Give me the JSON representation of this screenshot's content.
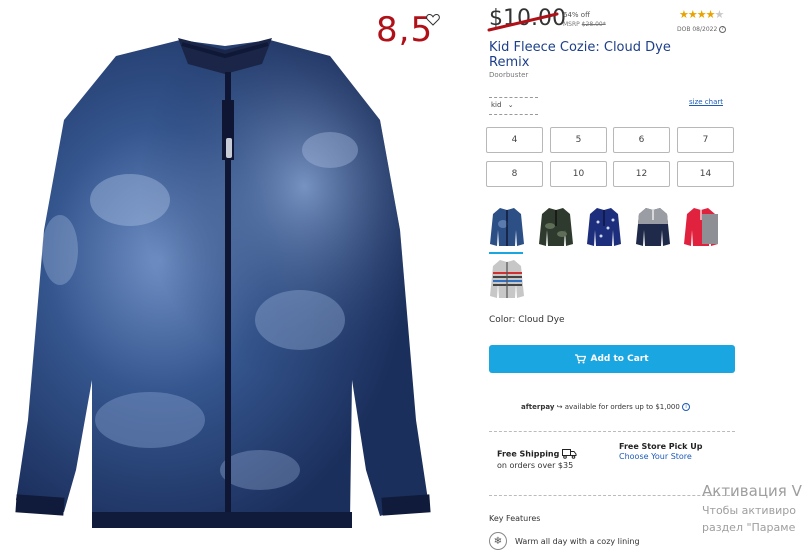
{
  "image": {
    "price_overlay": "8,5",
    "alt_subject": "jacket-image"
  },
  "product": {
    "price": "$10.00",
    "percent_off": "64% off",
    "msrp_label": "MSRP",
    "msrp_value": "$28.00*",
    "rating_stars": 4,
    "dob": "DOB 08/2022",
    "title": "Kid Fleece Cozie: Cloud Dye Remix",
    "subtitle": "Doorbuster"
  },
  "size_selector": {
    "selected": "kid",
    "size_chart_label": "size chart",
    "sizes": [
      "4",
      "5",
      "6",
      "7",
      "8",
      "10",
      "12",
      "14"
    ]
  },
  "swatches": [
    {
      "name": "cloud-dye",
      "colors": [
        "#2c4f86",
        "#1a2f5a"
      ],
      "selected": true
    },
    {
      "name": "camo",
      "colors": [
        "#2e3a2e",
        "#4f5d4a"
      ],
      "selected": false
    },
    {
      "name": "navy-print",
      "colors": [
        "#1d2f7c",
        "#3f55b5"
      ],
      "selected": false
    },
    {
      "name": "grey-navy",
      "colors": [
        "#9a9ea4",
        "#1f2a4a"
      ],
      "selected": false
    },
    {
      "name": "red-grey",
      "colors": [
        "#e0223f",
        "#8d8f95"
      ],
      "selected": false
    },
    {
      "name": "grey-stripe",
      "colors": [
        "#c7c7c7",
        "#444444"
      ],
      "selected": false
    }
  ],
  "color_label": "Color: Cloud Dye",
  "cart": {
    "label": "Add to Cart",
    "color": "#1aa6e0"
  },
  "afterpay": {
    "brand": "afterpay",
    "text": "available for orders up to $1,000"
  },
  "shipping": {
    "title": "Free Shipping",
    "subtitle": "on orders over $35"
  },
  "store_pickup": {
    "title": "Free Store Pick Up",
    "link": "Choose Your Store"
  },
  "key_features": {
    "title": "Key Features",
    "items": [
      "Warm all day with a cozy lining"
    ]
  },
  "activation_watermark": {
    "title": "Активация V",
    "line1": "Чтобы активиро",
    "line2": "раздел \"Параме"
  },
  "colors": {
    "price_overlay": "#b01018",
    "title_blue": "#1d3f8a",
    "accent": "#1aa6e0",
    "star": "#e8a300"
  }
}
